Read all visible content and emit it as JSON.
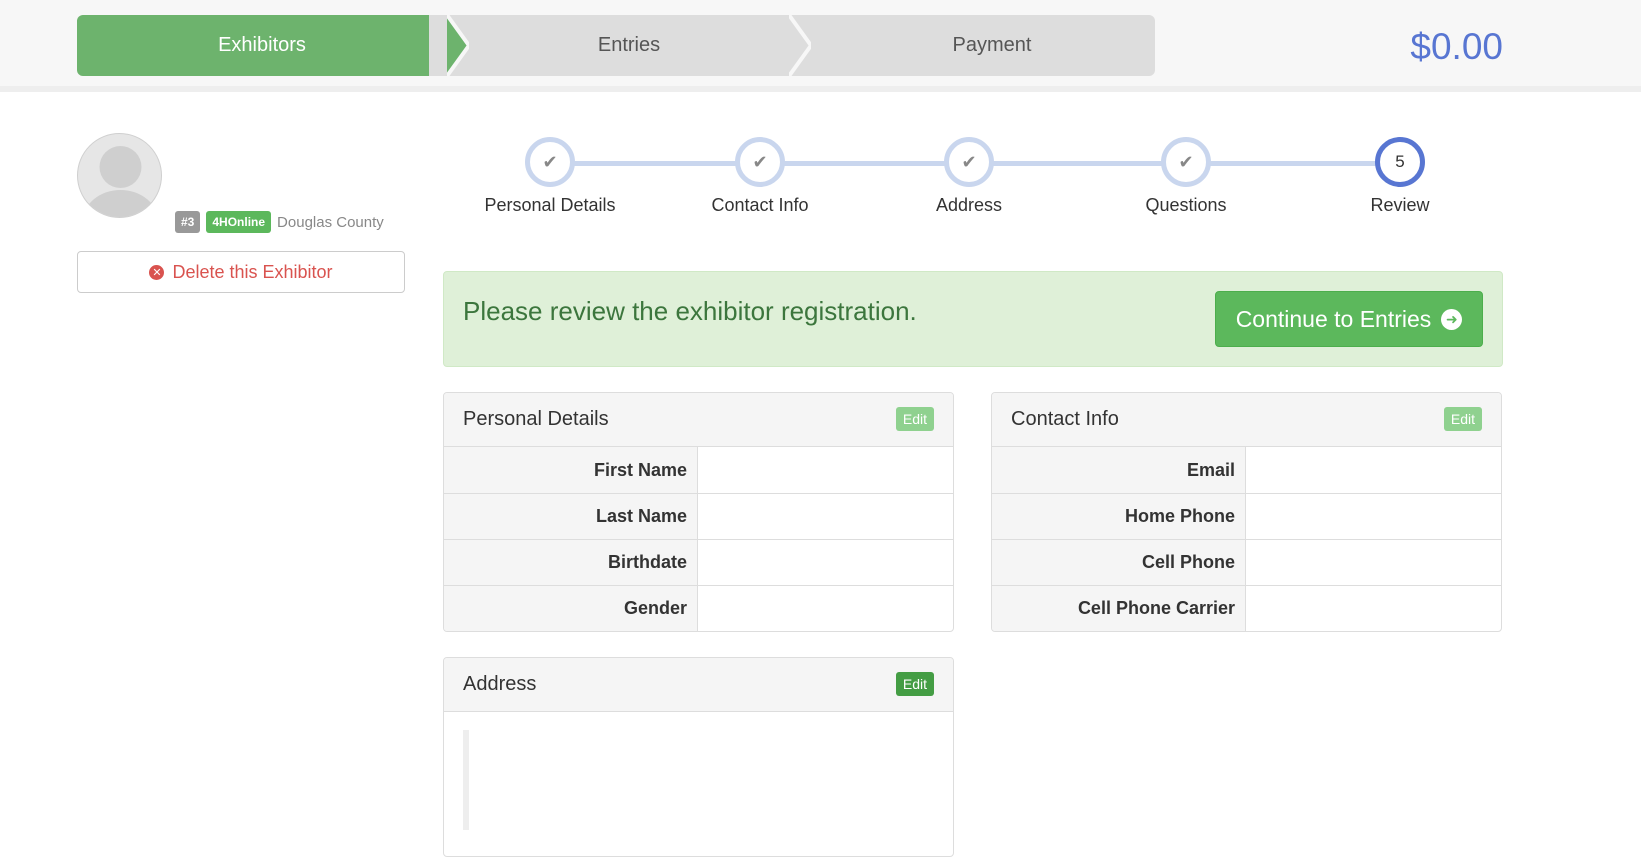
{
  "wizard": {
    "steps": [
      "Exhibitors",
      "Entries",
      "Payment"
    ],
    "active_step": 0,
    "total": "$0.00"
  },
  "exhibitor": {
    "number_badge": "#3",
    "source_badge": "4HOnline",
    "county": "Douglas County",
    "delete_label": "Delete this Exhibitor"
  },
  "stepper": {
    "steps": [
      {
        "label": "Personal Details",
        "state": "done"
      },
      {
        "label": "Contact Info",
        "state": "done"
      },
      {
        "label": "Address",
        "state": "done"
      },
      {
        "label": "Questions",
        "state": "done"
      },
      {
        "label": "Review",
        "state": "active",
        "number": "5"
      }
    ]
  },
  "alert": {
    "message": "Please review the exhibitor registration.",
    "continue_label": "Continue to Entries"
  },
  "panels": {
    "personal": {
      "title": "Personal Details",
      "edit_label": "Edit",
      "fields": [
        {
          "label": "First Name",
          "value": ""
        },
        {
          "label": "Last Name",
          "value": ""
        },
        {
          "label": "Birthdate",
          "value": ""
        },
        {
          "label": "Gender",
          "value": ""
        }
      ]
    },
    "contact": {
      "title": "Contact Info",
      "edit_label": "Edit",
      "fields": [
        {
          "label": "Email",
          "value": ""
        },
        {
          "label": "Home Phone",
          "value": ""
        },
        {
          "label": "Cell Phone",
          "value": ""
        },
        {
          "label": "Cell Phone Carrier",
          "value": ""
        }
      ]
    },
    "address": {
      "title": "Address",
      "edit_label": "Edit"
    }
  },
  "colors": {
    "active_step": "#6db36d",
    "inactive_step": "#dddddd",
    "total": "#5876d2",
    "danger": "#d9534f",
    "success": "#5cb85c"
  }
}
